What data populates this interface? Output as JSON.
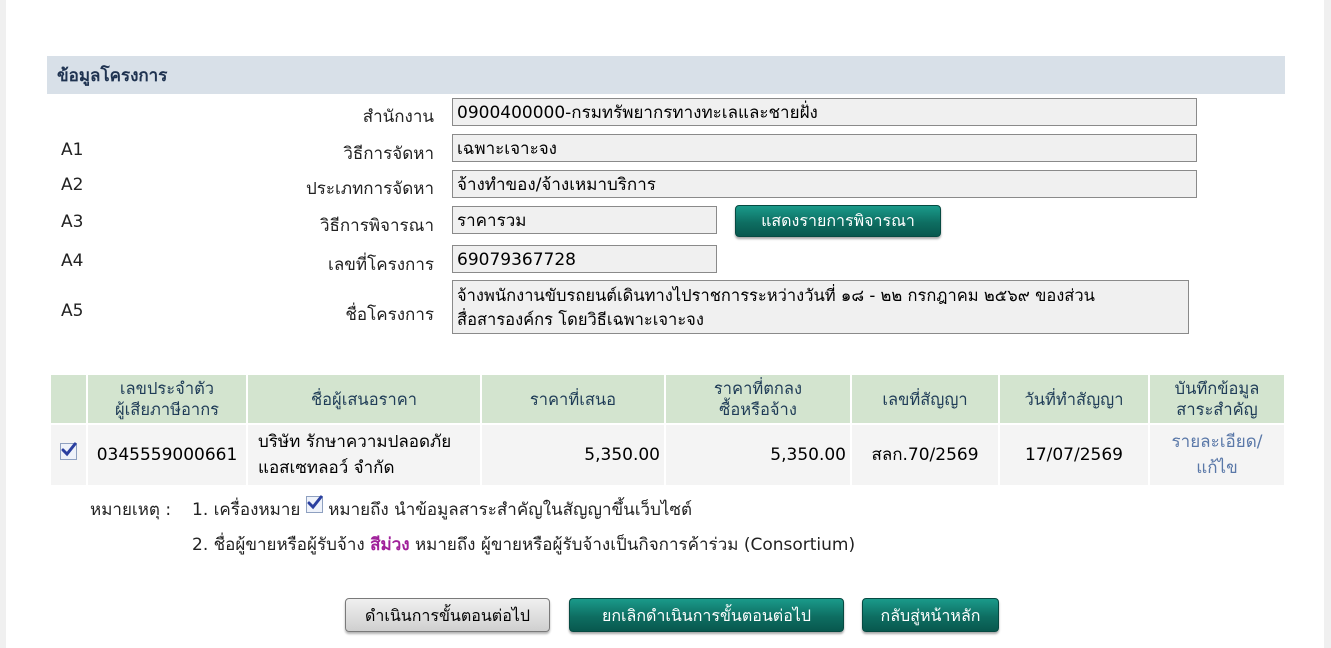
{
  "section": {
    "title": "ข้อมูลโครงการ"
  },
  "fields": {
    "office": {
      "code": "",
      "label": "สำนักงาน",
      "value": "0900400000-กรมทรัพยากรทางทะเลและชายฝั่ง"
    },
    "method": {
      "code": "A1",
      "label": "วิธีการจัดหา",
      "value": "เฉพาะเจาะจง"
    },
    "type": {
      "code": "A2",
      "label": "ประเภทการจัดหา",
      "value": "จ้างทำของ/จ้างเหมาบริการ"
    },
    "criteria": {
      "code": "A3",
      "label": "วิธีการพิจารณา",
      "value": "ราคารวม",
      "button": "แสดงรายการพิจารณา"
    },
    "project_no": {
      "code": "A4",
      "label": "เลขที่โครงการ",
      "value": "69079367728"
    },
    "project_name": {
      "code": "A5",
      "label": "ชื่อโครงการ",
      "line1": "จ้างพนักงานขับรถยนต์เดินทางไปราชการระหว่างวันที่ ๑๘ - ๒๒ กรกฎาคม ๒๕๖๙ ของส่วน",
      "line2": "สื่อสารองค์กร โดยวิธีเฉพาะเจาะจง"
    }
  },
  "table": {
    "headers": {
      "tax_id_1": "เลขประจำตัว",
      "tax_id_2": "ผู้เสียภาษีอากร",
      "bidder": "ชื่อผู้เสนอราคา",
      "offer": "ราคาที่เสนอ",
      "agreed_1": "ราคาที่ตกลง",
      "agreed_2": "ซื้อหรือจ้าง",
      "contract_no": "เลขที่สัญญา",
      "contract_date": "วันที่ทำสัญญา",
      "record_1": "บันทึกข้อมูล",
      "record_2": "สาระสำคัญ"
    },
    "rows": [
      {
        "checked": true,
        "tax_id": "0345559000661",
        "bidder_1": "บริษัท รักษาความปลอดภัย",
        "bidder_2": "แอสเซทลอว์ จำกัด",
        "offer": "5,350.00",
        "agreed": "5,350.00",
        "contract_no": "สลก.70/2569",
        "contract_date": "17/07/2569",
        "link_1": "รายละเอียด/",
        "link_2": "แก้ไข"
      }
    ]
  },
  "notes": {
    "label": "หมายเหตุ :",
    "n1_prefix": "1. เครื่องหมาย",
    "n1_suffix": "หมายถึง นำข้อมูลสาระสำคัญในสัญญาขึ้นเว็บไซต์",
    "n2_prefix": "2. ชื่อผู้ขายหรือผู้รับจ้าง",
    "n2_purple": "สีม่วง",
    "n2_suffix": "หมายถึง ผู้ขายหรือผู้รับจ้างเป็นกิจการค้าร่วม (Consortium)"
  },
  "buttons": {
    "next": "ดำเนินการขั้นตอนต่อไป",
    "cancel_next": "ยกเลิกดำเนินการขั้นตอนต่อไป",
    "home": "กลับสู่หน้าหลัก"
  },
  "colors": {
    "header_bg": "#d8e0e8",
    "table_header_bg": "#d3e4cf",
    "teal": "#0e6e62",
    "purple": "#a0209a",
    "link": "#5a78a8"
  }
}
